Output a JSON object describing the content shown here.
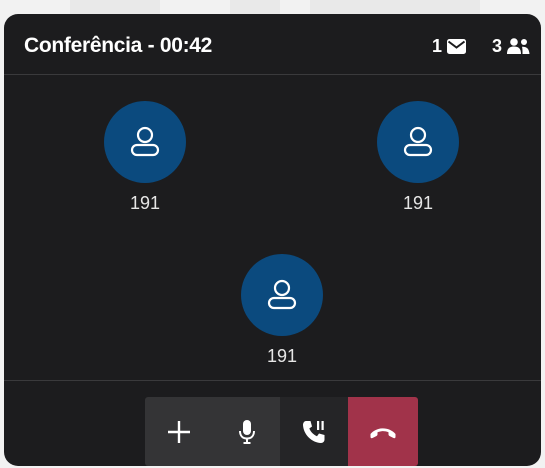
{
  "call": {
    "title": "Conferência - 00:42",
    "messages_count": "1",
    "participants_count": "3"
  },
  "participants": [
    {
      "name": "191"
    },
    {
      "name": "191"
    },
    {
      "name": "191"
    }
  ],
  "controls": {
    "add": {
      "icon": "plus-icon"
    },
    "mic": {
      "icon": "microphone-icon"
    },
    "hold": {
      "icon": "phone-pause-icon"
    },
    "hangup": {
      "icon": "phone-hangup-icon"
    }
  },
  "colors": {
    "window_bg": "#1c1c1e",
    "avatar_bg": "#0b4a7e",
    "control_bg": "#343436",
    "hold_bg": "#252527",
    "hangup_bg": "#a1334a",
    "text": "#ffffff"
  }
}
